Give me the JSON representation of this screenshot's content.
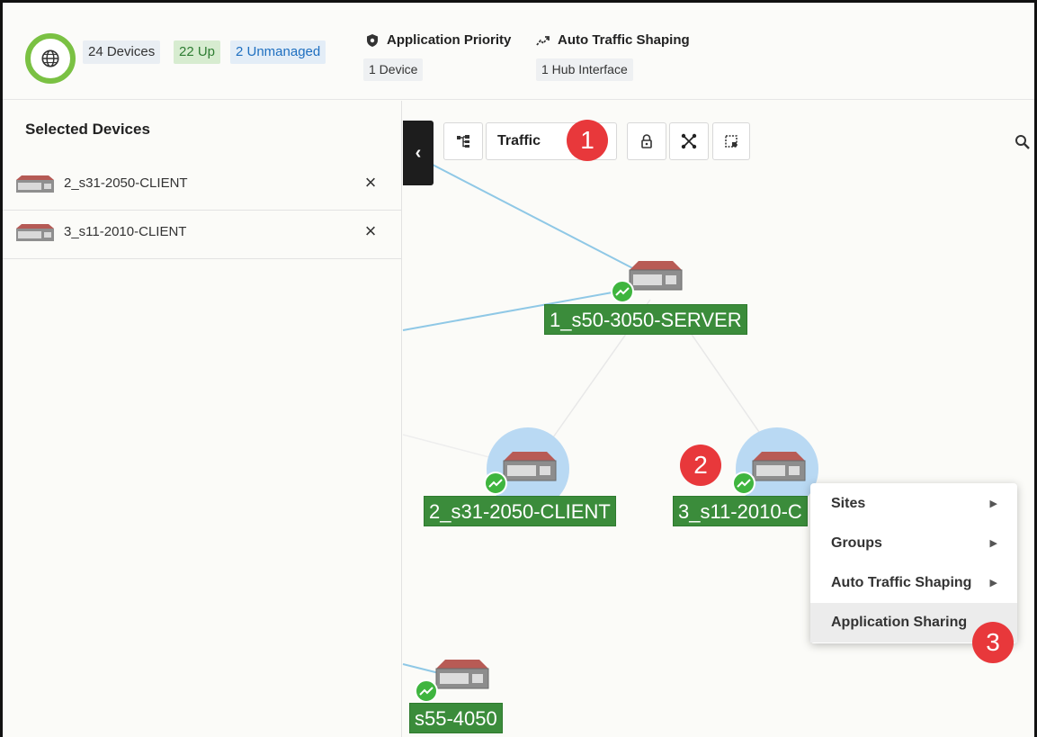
{
  "summary": {
    "devices": "24 Devices",
    "up": "22 Up",
    "unmanaged": "2 Unmanaged"
  },
  "features": {
    "application_priority": {
      "title": "Application Priority",
      "tag": "1 Device"
    },
    "auto_traffic_shaping": {
      "title": "Auto Traffic Shaping",
      "tag": "1 Hub Interface"
    }
  },
  "panel": {
    "title": "Selected Devices",
    "items": [
      {
        "name": "2_s31-2050-CLIENT",
        "close": "×"
      },
      {
        "name": "3_s11-2010-CLIENT",
        "close": "×"
      }
    ]
  },
  "toolbar": {
    "collapse": "‹",
    "view_select": "Traffic"
  },
  "map": {
    "nodes": [
      {
        "label": "1_s50-3050-SERVER"
      },
      {
        "label": "2_s31-2050-CLIENT"
      },
      {
        "label": "3_s11-2010-C"
      },
      {
        "label": "s55-4050"
      }
    ]
  },
  "context_menu": {
    "items": [
      {
        "label": "Sites",
        "arrow": "▶"
      },
      {
        "label": "Groups",
        "arrow": "▶"
      },
      {
        "label": "Auto Traffic Shaping",
        "arrow": "▶"
      },
      {
        "label": "Application Sharing",
        "arrow": ""
      }
    ]
  },
  "callouts": [
    "1",
    "2",
    "3"
  ],
  "colors": {
    "accent_green": "#7ac143",
    "node_label_green": "#3b8c3b",
    "callout_red": "#e8383b",
    "link_blue": "#8fc8e6"
  },
  "icons": {
    "globe": "globe-icon",
    "application_priority": "shield-icon",
    "auto_traffic_shaping": "trend-icon",
    "hierarchy": "hierarchy-icon",
    "lock": "lock-icon",
    "layout": "network-layout-icon",
    "select": "select-area-icon",
    "search": "search-icon"
  }
}
